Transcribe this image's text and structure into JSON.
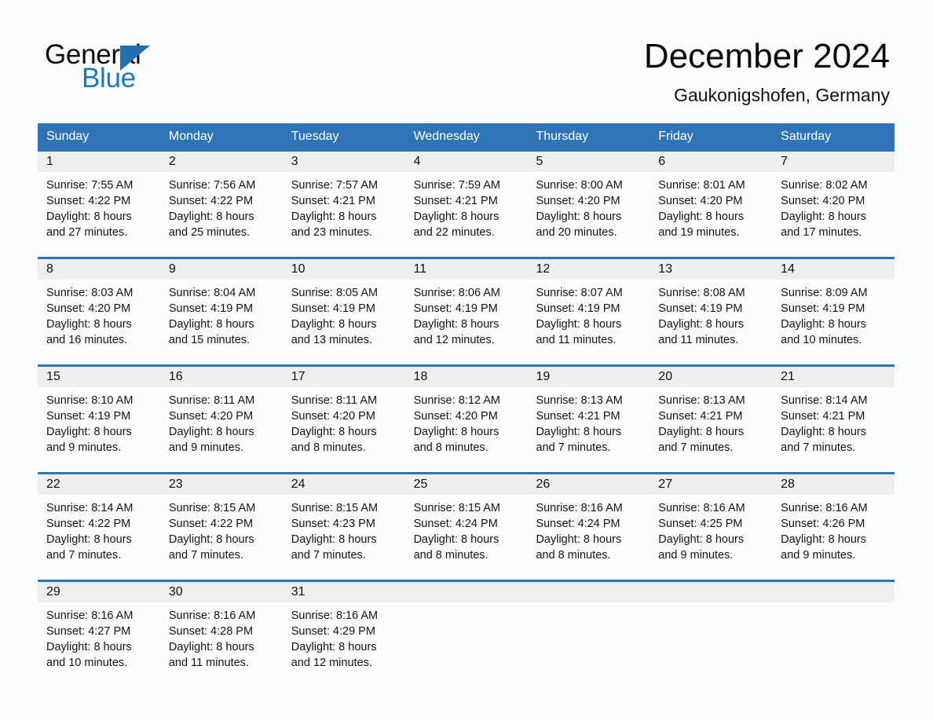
{
  "brand": {
    "name_part1": "General",
    "name_part2": "Blue",
    "logo_icon": "triangle-flag-icon",
    "accent_color": "#1f6fb5"
  },
  "header": {
    "title": "December 2024",
    "location": "Gaukonigshofen, Germany"
  },
  "calendar": {
    "header_bg": "#2f74b5",
    "date_band_bg": "#efefef",
    "weekdays": [
      "Sunday",
      "Monday",
      "Tuesday",
      "Wednesday",
      "Thursday",
      "Friday",
      "Saturday"
    ],
    "weeks": [
      {
        "days": [
          {
            "date": "1",
            "sunrise": "Sunrise: 7:55 AM",
            "sunset": "Sunset: 4:22 PM",
            "daylight_line1": "Daylight: 8 hours",
            "daylight_line2": "and 27 minutes."
          },
          {
            "date": "2",
            "sunrise": "Sunrise: 7:56 AM",
            "sunset": "Sunset: 4:22 PM",
            "daylight_line1": "Daylight: 8 hours",
            "daylight_line2": "and 25 minutes."
          },
          {
            "date": "3",
            "sunrise": "Sunrise: 7:57 AM",
            "sunset": "Sunset: 4:21 PM",
            "daylight_line1": "Daylight: 8 hours",
            "daylight_line2": "and 23 minutes."
          },
          {
            "date": "4",
            "sunrise": "Sunrise: 7:59 AM",
            "sunset": "Sunset: 4:21 PM",
            "daylight_line1": "Daylight: 8 hours",
            "daylight_line2": "and 22 minutes."
          },
          {
            "date": "5",
            "sunrise": "Sunrise: 8:00 AM",
            "sunset": "Sunset: 4:20 PM",
            "daylight_line1": "Daylight: 8 hours",
            "daylight_line2": "and 20 minutes."
          },
          {
            "date": "6",
            "sunrise": "Sunrise: 8:01 AM",
            "sunset": "Sunset: 4:20 PM",
            "daylight_line1": "Daylight: 8 hours",
            "daylight_line2": "and 19 minutes."
          },
          {
            "date": "7",
            "sunrise": "Sunrise: 8:02 AM",
            "sunset": "Sunset: 4:20 PM",
            "daylight_line1": "Daylight: 8 hours",
            "daylight_line2": "and 17 minutes."
          }
        ]
      },
      {
        "days": [
          {
            "date": "8",
            "sunrise": "Sunrise: 8:03 AM",
            "sunset": "Sunset: 4:20 PM",
            "daylight_line1": "Daylight: 8 hours",
            "daylight_line2": "and 16 minutes."
          },
          {
            "date": "9",
            "sunrise": "Sunrise: 8:04 AM",
            "sunset": "Sunset: 4:19 PM",
            "daylight_line1": "Daylight: 8 hours",
            "daylight_line2": "and 15 minutes."
          },
          {
            "date": "10",
            "sunrise": "Sunrise: 8:05 AM",
            "sunset": "Sunset: 4:19 PM",
            "daylight_line1": "Daylight: 8 hours",
            "daylight_line2": "and 13 minutes."
          },
          {
            "date": "11",
            "sunrise": "Sunrise: 8:06 AM",
            "sunset": "Sunset: 4:19 PM",
            "daylight_line1": "Daylight: 8 hours",
            "daylight_line2": "and 12 minutes."
          },
          {
            "date": "12",
            "sunrise": "Sunrise: 8:07 AM",
            "sunset": "Sunset: 4:19 PM",
            "daylight_line1": "Daylight: 8 hours",
            "daylight_line2": "and 11 minutes."
          },
          {
            "date": "13",
            "sunrise": "Sunrise: 8:08 AM",
            "sunset": "Sunset: 4:19 PM",
            "daylight_line1": "Daylight: 8 hours",
            "daylight_line2": "and 11 minutes."
          },
          {
            "date": "14",
            "sunrise": "Sunrise: 8:09 AM",
            "sunset": "Sunset: 4:19 PM",
            "daylight_line1": "Daylight: 8 hours",
            "daylight_line2": "and 10 minutes."
          }
        ]
      },
      {
        "days": [
          {
            "date": "15",
            "sunrise": "Sunrise: 8:10 AM",
            "sunset": "Sunset: 4:19 PM",
            "daylight_line1": "Daylight: 8 hours",
            "daylight_line2": "and 9 minutes."
          },
          {
            "date": "16",
            "sunrise": "Sunrise: 8:11 AM",
            "sunset": "Sunset: 4:20 PM",
            "daylight_line1": "Daylight: 8 hours",
            "daylight_line2": "and 9 minutes."
          },
          {
            "date": "17",
            "sunrise": "Sunrise: 8:11 AM",
            "sunset": "Sunset: 4:20 PM",
            "daylight_line1": "Daylight: 8 hours",
            "daylight_line2": "and 8 minutes."
          },
          {
            "date": "18",
            "sunrise": "Sunrise: 8:12 AM",
            "sunset": "Sunset: 4:20 PM",
            "daylight_line1": "Daylight: 8 hours",
            "daylight_line2": "and 8 minutes."
          },
          {
            "date": "19",
            "sunrise": "Sunrise: 8:13 AM",
            "sunset": "Sunset: 4:21 PM",
            "daylight_line1": "Daylight: 8 hours",
            "daylight_line2": "and 7 minutes."
          },
          {
            "date": "20",
            "sunrise": "Sunrise: 8:13 AM",
            "sunset": "Sunset: 4:21 PM",
            "daylight_line1": "Daylight: 8 hours",
            "daylight_line2": "and 7 minutes."
          },
          {
            "date": "21",
            "sunrise": "Sunrise: 8:14 AM",
            "sunset": "Sunset: 4:21 PM",
            "daylight_line1": "Daylight: 8 hours",
            "daylight_line2": "and 7 minutes."
          }
        ]
      },
      {
        "days": [
          {
            "date": "22",
            "sunrise": "Sunrise: 8:14 AM",
            "sunset": "Sunset: 4:22 PM",
            "daylight_line1": "Daylight: 8 hours",
            "daylight_line2": "and 7 minutes."
          },
          {
            "date": "23",
            "sunrise": "Sunrise: 8:15 AM",
            "sunset": "Sunset: 4:22 PM",
            "daylight_line1": "Daylight: 8 hours",
            "daylight_line2": "and 7 minutes."
          },
          {
            "date": "24",
            "sunrise": "Sunrise: 8:15 AM",
            "sunset": "Sunset: 4:23 PM",
            "daylight_line1": "Daylight: 8 hours",
            "daylight_line2": "and 7 minutes."
          },
          {
            "date": "25",
            "sunrise": "Sunrise: 8:15 AM",
            "sunset": "Sunset: 4:24 PM",
            "daylight_line1": "Daylight: 8 hours",
            "daylight_line2": "and 8 minutes."
          },
          {
            "date": "26",
            "sunrise": "Sunrise: 8:16 AM",
            "sunset": "Sunset: 4:24 PM",
            "daylight_line1": "Daylight: 8 hours",
            "daylight_line2": "and 8 minutes."
          },
          {
            "date": "27",
            "sunrise": "Sunrise: 8:16 AM",
            "sunset": "Sunset: 4:25 PM",
            "daylight_line1": "Daylight: 8 hours",
            "daylight_line2": "and 9 minutes."
          },
          {
            "date": "28",
            "sunrise": "Sunrise: 8:16 AM",
            "sunset": "Sunset: 4:26 PM",
            "daylight_line1": "Daylight: 8 hours",
            "daylight_line2": "and 9 minutes."
          }
        ]
      },
      {
        "days": [
          {
            "date": "29",
            "sunrise": "Sunrise: 8:16 AM",
            "sunset": "Sunset: 4:27 PM",
            "daylight_line1": "Daylight: 8 hours",
            "daylight_line2": "and 10 minutes."
          },
          {
            "date": "30",
            "sunrise": "Sunrise: 8:16 AM",
            "sunset": "Sunset: 4:28 PM",
            "daylight_line1": "Daylight: 8 hours",
            "daylight_line2": "and 11 minutes."
          },
          {
            "date": "31",
            "sunrise": "Sunrise: 8:16 AM",
            "sunset": "Sunset: 4:29 PM",
            "daylight_line1": "Daylight: 8 hours",
            "daylight_line2": "and 12 minutes."
          },
          {
            "date": "",
            "sunrise": "",
            "sunset": "",
            "daylight_line1": "",
            "daylight_line2": ""
          },
          {
            "date": "",
            "sunrise": "",
            "sunset": "",
            "daylight_line1": "",
            "daylight_line2": ""
          },
          {
            "date": "",
            "sunrise": "",
            "sunset": "",
            "daylight_line1": "",
            "daylight_line2": ""
          },
          {
            "date": "",
            "sunrise": "",
            "sunset": "",
            "daylight_line1": "",
            "daylight_line2": ""
          }
        ]
      }
    ]
  }
}
